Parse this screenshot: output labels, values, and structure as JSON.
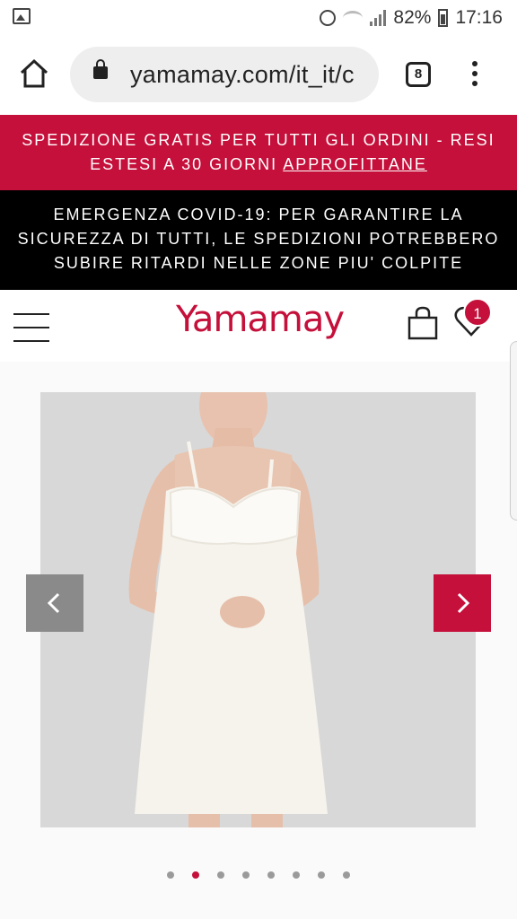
{
  "status_bar": {
    "battery": "82%",
    "time": "17:16",
    "icons": [
      "gallery-icon",
      "alarm-icon",
      "wifi-icon",
      "signal-icon",
      "battery-icon"
    ]
  },
  "browser": {
    "url": "yamamay.com/it_it/c",
    "tab_count": "8",
    "icons": [
      "home-icon",
      "lock-icon",
      "tabs-icon",
      "more-vert-icon"
    ]
  },
  "promo": {
    "line1": "SPEDIZIONE GRATIS PER TUTTI GLI ORDINI - RESI",
    "line2": "ESTESI A 30 GIORNI",
    "link": "APPROFITTANE"
  },
  "covid": {
    "line1": "EMERGENZA COVID-19: PER GARANTIRE LA",
    "line2": "SICUREZZA DI TUTTI, LE SPEDIZIONI POTREBBERO",
    "line3": "SUBIRE RITARDI NELLE ZONE PIU' COLPITE"
  },
  "header": {
    "logo": "Yamamay",
    "wishlist_count": "1",
    "icons": [
      "hamburger-menu-icon",
      "shopping-bag-icon",
      "wishlist-heart-icon"
    ]
  },
  "gallery": {
    "slide_count": 8,
    "active_slide": 2,
    "prev_icon": "chevron-left-icon",
    "next_icon": "chevron-right-icon"
  },
  "colors": {
    "brand": "#c4103a",
    "banner_black": "#000000"
  }
}
